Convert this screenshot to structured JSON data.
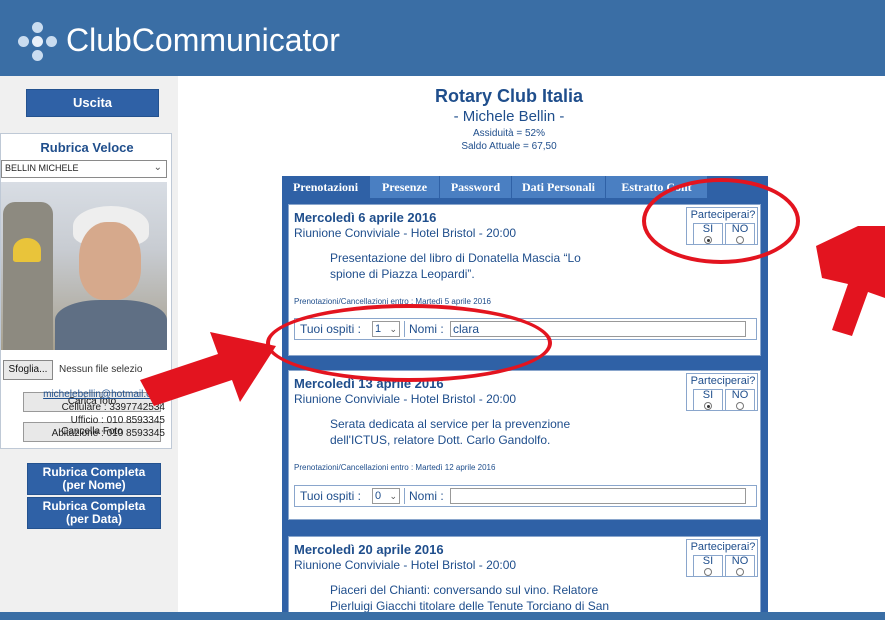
{
  "app": {
    "title": "ClubCommunicator"
  },
  "sidebar": {
    "exit_button": "Uscita",
    "quick_book": {
      "title": "Rubrica Veloce",
      "selected_member": "BELLIN MICHELE",
      "browse_button": "Sfoglia...",
      "no_file_text": "Nessun file selezio",
      "upload_photo": "Carica foto",
      "delete_photo": "Cancella Foto",
      "email": "michelebellin@hotmail.com",
      "mobile": "Cellulare : 3397742534",
      "office": "Ufficio : 010 8593345",
      "home": "Abitazione : 010 8593345"
    },
    "full_book_by_name": [
      "Rubrica Completa",
      "(per Nome)"
    ],
    "full_book_by_date": [
      "Rubrica Completa",
      "(per Data)"
    ]
  },
  "main": {
    "club_name": "Rotary Club Italia",
    "member_name": "- Michele Bellin -",
    "attendance": "Assiduità = 52%",
    "balance": "Saldo Attuale = 67,50",
    "tabs": [
      "Prenotazioni",
      "Presenze",
      "Password",
      "Dati Personali",
      "Estratto Cont"
    ],
    "active_tab": "Prenotazioni",
    "participation_title": "Parteciperai?",
    "yes_label": "SI",
    "no_label": "NO",
    "guests_label": "Tuoi ospiti :",
    "names_label": "Nomi :",
    "events": [
      {
        "date": "Mercoledì 6 aprile 2016",
        "subtitle": "Riunione Conviviale - Hotel Bristol - 20:00",
        "description_lines": [
          "Presentazione del libro di Donatella Mascia “Lo",
          "spione di Piazza Leopardi”."
        ],
        "deadline": "Prenotazioni/Cancellazioni entro : Martedì 5 aprile 2016",
        "guests": "1",
        "names": "clara",
        "participation": "SI"
      },
      {
        "date": "Mercoledì 13 aprile 2016",
        "subtitle": "Riunione Conviviale - Hotel Bristol - 20:00",
        "description_lines": [
          "Serata dedicata al service per la prevenzione",
          "dell'ICTUS, relatore Dott. Carlo Gandolfo."
        ],
        "deadline": "Prenotazioni/Cancellazioni entro : Martedì 12 aprile 2016",
        "guests": "0",
        "names": "",
        "participation": "SI"
      },
      {
        "date": "Mercoledì 20 aprile 2016",
        "subtitle": "Riunione Conviviale - Hotel Bristol - 20:00",
        "description_lines": [
          "Piaceri del Chianti: conversando sul vino. Relatore",
          "Pierluigi Giacchi titolare delle Tenute Torciano di San"
        ],
        "deadline": "",
        "guests": "",
        "names": "",
        "participation": ""
      }
    ]
  },
  "colors": {
    "header": "#3a6ea5",
    "panel": "#2f61a6",
    "text_blue": "#1f4e8c",
    "annotation_red": "#e3141f"
  }
}
